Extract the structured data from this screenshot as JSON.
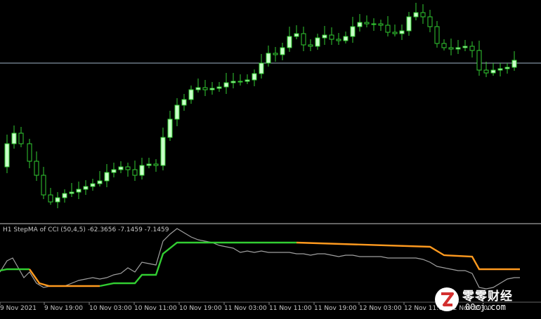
{
  "indicator": {
    "label": "H1 StepMA of CCI (50,4,5) -62.3656 -7.1459 -7.1459"
  },
  "time_axis": {
    "labels": [
      "9 Nov 2021",
      "9 Nov 19:00",
      "10 Nov 03:00",
      "10 Nov 11:00",
      "10 Nov 19:00",
      "11 Nov 03:00",
      "11 Nov 11:00",
      "11 Nov 19:00",
      "12 Nov 03:00",
      "12 Nov 11:00",
      "12 Nov 19:00"
    ]
  },
  "watermark": {
    "text": "零零财经",
    "url": "00cj.com"
  },
  "colors": {
    "background": "#000000",
    "bull_candle": "#c8ffc8",
    "bear_candle": "#000000",
    "candle_border": "#32cd32",
    "hline": "#a0b4c8",
    "cci_line": "#a0a0a0",
    "stepma_up": "#32cd32",
    "stepma_down": "#ff9a1f",
    "separator": "#c8c8c8"
  }
}
